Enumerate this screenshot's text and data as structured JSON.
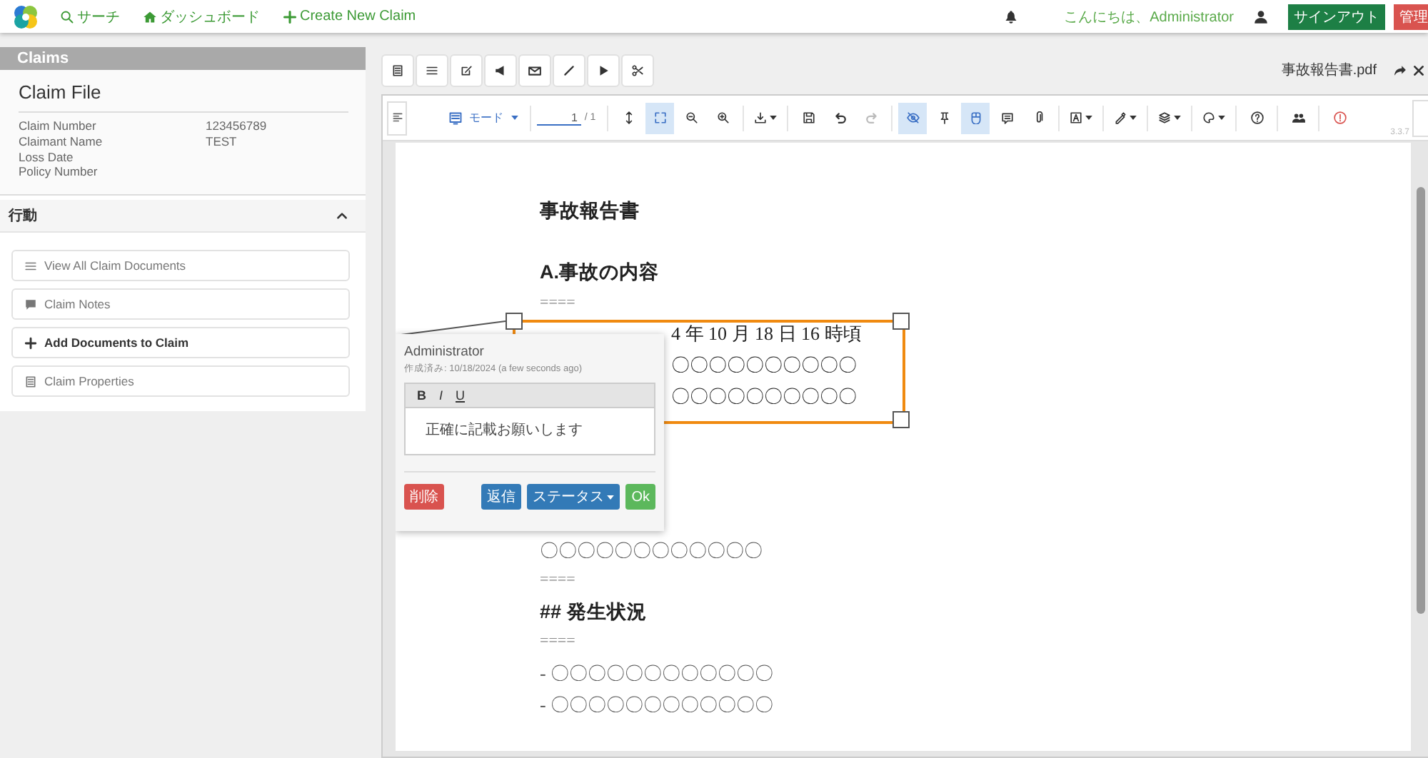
{
  "nav": {
    "links": [
      {
        "kind": "search",
        "label": "サーチ"
      },
      {
        "kind": "home",
        "label": "ダッシュボード"
      },
      {
        "kind": "plus",
        "label": "Create New Claim"
      }
    ],
    "greeting": "こんにちは、Administrator",
    "signout": "サインアウト",
    "admin": "管理"
  },
  "sidebar": {
    "header": "Claims",
    "card_title": "Claim File",
    "fields": [
      {
        "label": "Claim Number",
        "value": "123456789"
      },
      {
        "label": "Claimant Name",
        "value": "TEST"
      },
      {
        "label": "Loss Date"
      },
      {
        "label": "Policy Number"
      }
    ],
    "actions_title": "行動",
    "expanded": true,
    "actions": [
      {
        "kind": "list",
        "label": "View All Claim Documents"
      },
      {
        "kind": "comment",
        "label": "Claim Notes"
      },
      {
        "kind": "plus",
        "label": "Add Documents to Claim"
      },
      {
        "kind": "book",
        "label": "Claim Properties"
      }
    ]
  },
  "viewer": {
    "top_tools": [
      {
        "kind": "book"
      },
      {
        "kind": "list"
      },
      {
        "kind": "edit"
      },
      {
        "kind": "bullhorn"
      },
      {
        "kind": "envelope"
      },
      {
        "kind": "pencil"
      },
      {
        "kind": "play"
      },
      {
        "kind": "scissors"
      }
    ],
    "file_name": "事故報告書.pdf",
    "mode_label": "モード",
    "page_value": "1",
    "page_total": "/ 1",
    "version": "3.3.7",
    "tools": [
      {
        "kind": "fit-height",
        "selected": false,
        "disabled": false
      },
      {
        "kind": "fullscreen",
        "selected": true,
        "disabled": false
      },
      {
        "kind": "zoom-out",
        "selected": false,
        "disabled": false
      },
      {
        "kind": "zoom-in",
        "selected": false,
        "disabled": false
      },
      {
        "kind": "download",
        "selected": false,
        "disabled": false
      },
      {
        "kind": "save",
        "selected": false,
        "disabled": false
      },
      {
        "kind": "undo",
        "selected": false,
        "disabled": false
      },
      {
        "kind": "redo",
        "selected": false,
        "disabled": true
      },
      {
        "kind": "eye-slash",
        "selected": true,
        "disabled": false
      },
      {
        "kind": "pin",
        "selected": false,
        "disabled": false
      },
      {
        "kind": "mouse",
        "selected": true,
        "disabled": false
      },
      {
        "kind": "note",
        "selected": false,
        "disabled": false
      },
      {
        "kind": "paperclip",
        "selected": false,
        "disabled": false
      },
      {
        "kind": "textbox",
        "selected": false,
        "disabled": false
      },
      {
        "kind": "pen",
        "selected": false,
        "disabled": false
      },
      {
        "kind": "layers",
        "selected": false,
        "disabled": false
      },
      {
        "kind": "palette",
        "selected": false,
        "disabled": false
      },
      {
        "kind": "help",
        "selected": false,
        "disabled": false
      },
      {
        "kind": "users",
        "selected": false,
        "disabled": false
      },
      {
        "kind": "info",
        "selected": false,
        "disabled": false
      }
    ]
  },
  "document": {
    "lines": [
      {
        "kind": "title",
        "text": "事故報告書"
      },
      {
        "kind": "blank"
      },
      {
        "kind": "heading",
        "text": "A.事故の内容"
      },
      {
        "kind": "rule",
        "text": "===="
      },
      {
        "kind": "covered",
        "text": "4 年 10 月 18 日 16 時頃"
      },
      {
        "kind": "covered",
        "text": "〇〇〇〇〇〇〇〇〇〇"
      },
      {
        "kind": "covered",
        "text": "〇〇〇〇〇〇〇〇〇〇"
      },
      {
        "kind": "blank"
      },
      {
        "kind": "blank"
      },
      {
        "kind": "blank"
      },
      {
        "kind": "blank"
      },
      {
        "kind": "body",
        "text": "〇〇〇〇〇〇〇〇〇〇〇〇"
      },
      {
        "kind": "rule",
        "text": "===="
      },
      {
        "kind": "heading",
        "text": "## 発生状況"
      },
      {
        "kind": "rule",
        "text": "===="
      },
      {
        "kind": "body",
        "text": "- 〇〇〇〇〇〇〇〇〇〇〇〇"
      },
      {
        "kind": "body",
        "text": "- 〇〇〇〇〇〇〇〇〇〇〇〇"
      }
    ]
  },
  "annotation": {
    "author": "Administrator",
    "created": "作成済み: 10/18/2024 (a few seconds ago)",
    "format_buttons": [
      "B",
      "I",
      "U"
    ],
    "comment": "正確に記載お願いします",
    "buttons": [
      {
        "kind": "danger",
        "label": "削除"
      },
      {
        "kind": "primary",
        "label": "返信"
      },
      {
        "kind": "dropdown",
        "label": "ステータス"
      },
      {
        "kind": "success",
        "label": "Ok"
      }
    ]
  }
}
